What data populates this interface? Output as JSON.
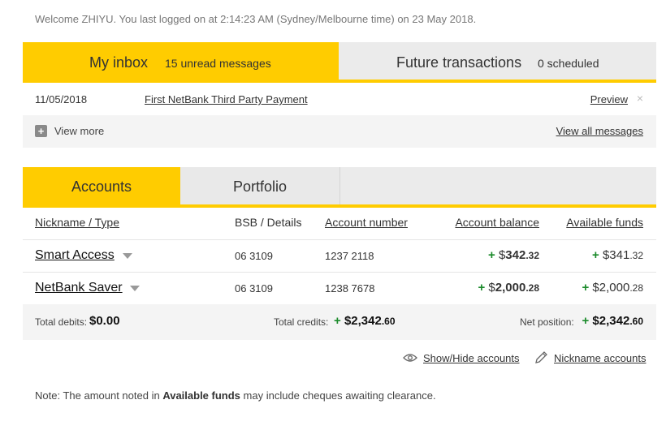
{
  "welcome": "Welcome ZHIYU. You last logged on at 2:14:23 AM (Sydney/Melbourne time) on 23 May 2018.",
  "inbox": {
    "tabs": [
      {
        "title": "My inbox",
        "sub": "15 unread messages"
      },
      {
        "title": "Future transactions",
        "sub": "0 scheduled"
      }
    ],
    "message": {
      "date": "11/05/2018",
      "subject": "First NetBank Third Party Payment",
      "preview": "Preview",
      "close": "×"
    },
    "view_more": "View more",
    "view_all": "View all messages"
  },
  "accounts": {
    "tabs": [
      "Accounts",
      "Portfolio"
    ],
    "headers": [
      "Nickname / Type",
      "BSB / Details",
      "Account number",
      "Account balance",
      "Available funds"
    ],
    "rows": [
      {
        "name": "Smart Access",
        "bsb": "06 3109",
        "number": "1237 2118",
        "bal_sign": "+",
        "bal_cur": "$",
        "bal_main": "342",
        "bal_cents": ".32",
        "av_sign": "+",
        "av_cur": "$",
        "av_main": "341",
        "av_cents": ".32"
      },
      {
        "name": "NetBank Saver",
        "bsb": "06 3109",
        "number": "1238 7678",
        "bal_sign": "+",
        "bal_cur": "$",
        "bal_main": "2,000",
        "bal_cents": ".28",
        "av_sign": "+",
        "av_cur": "$",
        "av_main": "2,000",
        "av_cents": ".28"
      }
    ],
    "totals": {
      "debits_label": "Total debits:",
      "debits_value": "$0.00",
      "credits_label": "Total credits:",
      "credits_sign": "+",
      "credits_main": "$2,342",
      "credits_cents": ".60",
      "net_label": "Net position:",
      "net_sign": "+",
      "net_main": "$2,342",
      "net_cents": ".60"
    },
    "actions": {
      "show_hide": "Show/Hide accounts",
      "nickname": "Nickname accounts"
    }
  },
  "note": {
    "prefix": "Note: The amount noted in ",
    "bold": "Available funds",
    "suffix": " may include cheques awaiting clearance."
  },
  "colors": {
    "accent": "#ffcc00",
    "positive": "#1a8a2a",
    "tab_inactive": "#ebebeb"
  },
  "icons": {
    "plus": "plus-square-icon",
    "eye": "eye-icon",
    "pencil": "pencil-icon",
    "caret": "chevron-down-icon",
    "close": "close-icon"
  }
}
